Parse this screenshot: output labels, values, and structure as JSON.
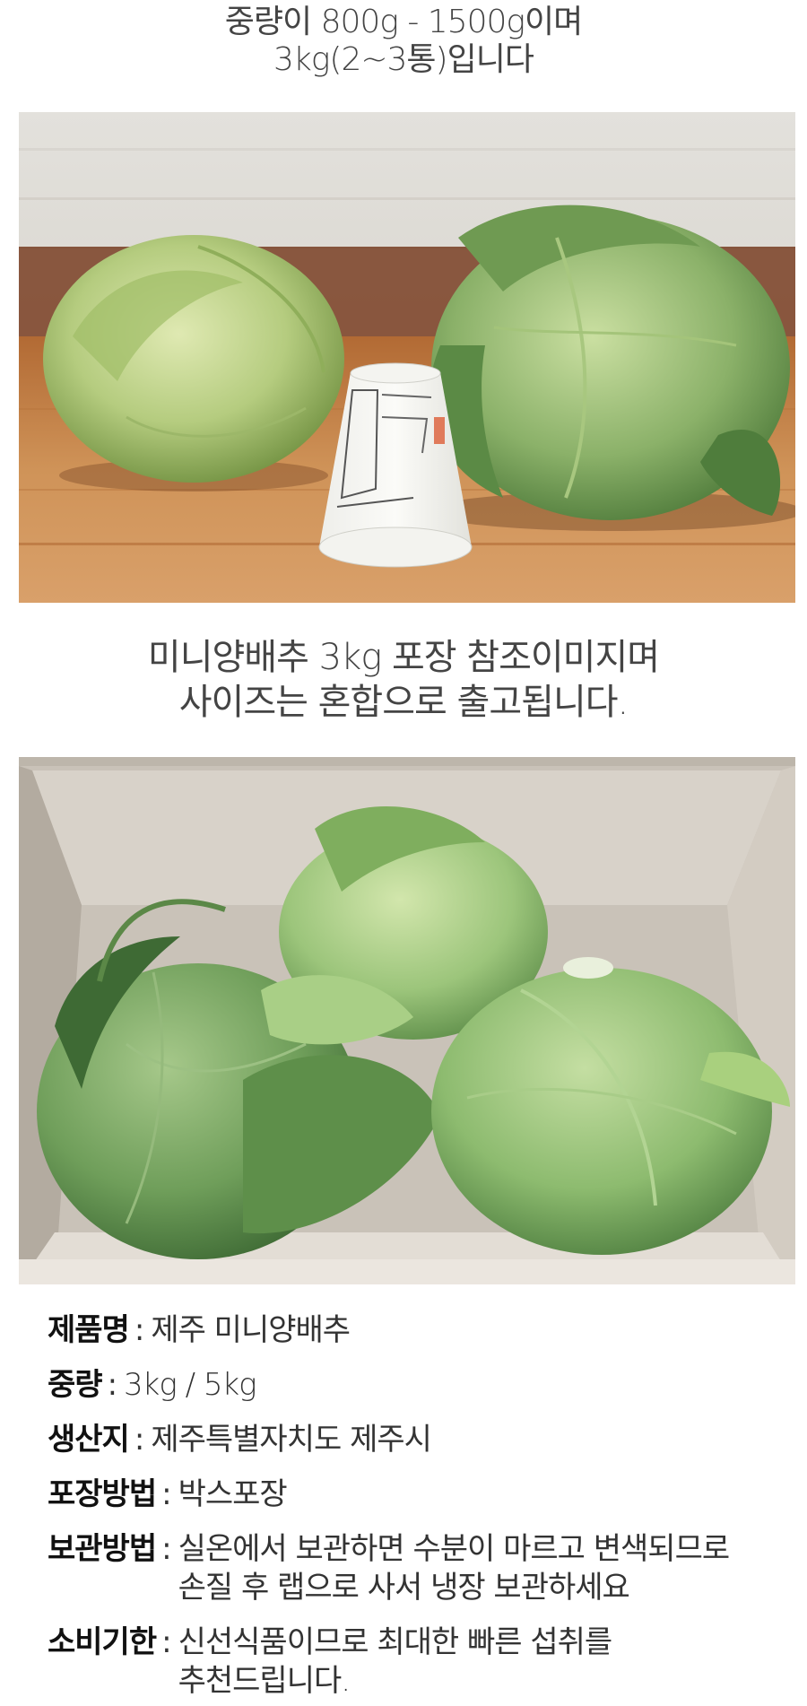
{
  "top_caption": {
    "line1": "중량이 800g - 1500g이며",
    "line2": "3kg(2~3통)입니다"
  },
  "mid_caption": {
    "line1": "미니양배추 3kg 포장 참조이미지며",
    "line2": "사이즈는 혼합으로 출고됩니다."
  },
  "specs": [
    {
      "label": "제품명",
      "lines": [
        "제주 미니양배추"
      ]
    },
    {
      "label": "중량",
      "lines": [
        "3kg / 5kg"
      ]
    },
    {
      "label": "생산지",
      "lines": [
        "제주특별자치도 제주시"
      ]
    },
    {
      "label": "포장방법",
      "lines": [
        "박스포장"
      ]
    },
    {
      "label": "보관방법",
      "lines": [
        "실온에서 보관하면 수분이 마르고 변색되므로",
        "손질 후 랩으로 사서 냉장 보관하세요"
      ]
    },
    {
      "label": "소비기한",
      "lines": [
        "신선식품이므로 최대한 빠른 섭취를",
        "추천드립니다."
      ]
    }
  ],
  "colors": {
    "cabbage_light": "#b8cf86",
    "cabbage_dark": "#6f9a52",
    "wood": "#c98a52",
    "box": "#cdc6bd"
  }
}
